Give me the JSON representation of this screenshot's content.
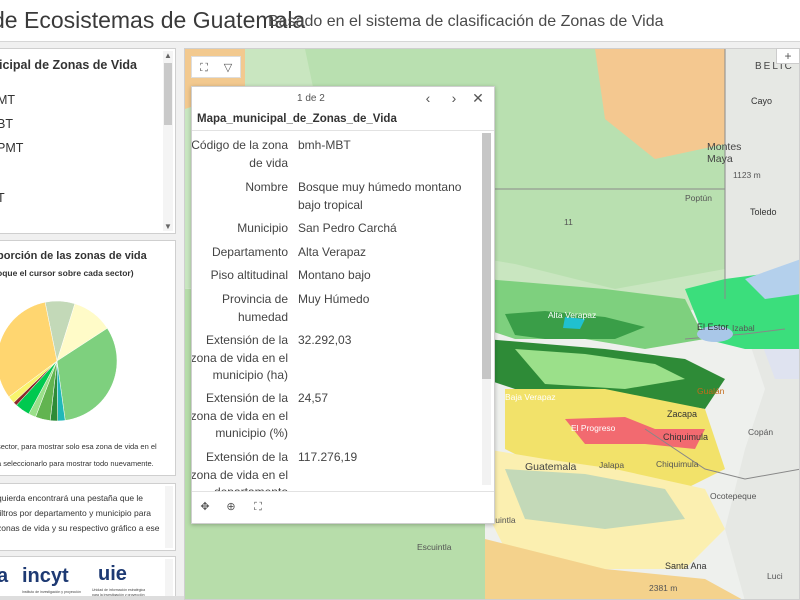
{
  "header": {
    "title": "de Ecosistemas de Guatemala",
    "subtitle": "Basado en el sistema de clasificación de Zonas de Vida"
  },
  "list_panel": {
    "title": "icipal de Zonas de Vida",
    "items": [
      "MT",
      "BT",
      "PMT",
      "T"
    ]
  },
  "chart_panel": {
    "title": "porción de las zonas de vida",
    "subtitle": "oque el cursor sobre cada sector)",
    "note_1": "sector, para mostrar solo esa zona de vida en el",
    "note_2": "a seleccionarlo para mostrar todo nuevamente."
  },
  "chart_data": {
    "type": "pie",
    "slices": [
      {
        "color": "#c3d9b8",
        "value": 8
      },
      {
        "color": "#fffbc8",
        "value": 11
      },
      {
        "color": "#7ed07e",
        "value": 32
      },
      {
        "color": "#20b8b8",
        "value": 2
      },
      {
        "color": "#2e8b37",
        "value": 2
      },
      {
        "color": "#62b450",
        "value": 4
      },
      {
        "color": "#9be08a",
        "value": 2
      },
      {
        "color": "#00c94f",
        "value": 4
      },
      {
        "color": "#8b2b2b",
        "value": 1
      },
      {
        "color": "#f8f46e",
        "value": 2
      },
      {
        "color": "#ffd670",
        "value": 32
      }
    ]
  },
  "text_panel": {
    "lines": [
      "quierda encontrará una pestaña que le",
      "filtros por departamento y municipio para",
      "zonas de vida y su respectivo gráfico a ese"
    ]
  },
  "logos": {
    "first": "a",
    "second": "incyt",
    "third": "uie",
    "second_small": "Instituto de investigación y proyección",
    "third_small_1": "Unidad de información estratégica",
    "third_small_2": "para la investigación y proyección"
  },
  "popup": {
    "pager": "1 de 2",
    "title": "Mapa_municipal_de_Zonas_de_Vida",
    "fields": [
      {
        "label": "Código de la zona de vida",
        "value": "bmh-MBT"
      },
      {
        "label": "Nombre",
        "value": "Bosque muy húmedo montano bajo tropical"
      },
      {
        "label": "Municipio",
        "value": "San Pedro Carchá"
      },
      {
        "label": "Departamento",
        "value": "Alta Verapaz"
      },
      {
        "label": "Piso altitudinal",
        "value": "Montano bajo"
      },
      {
        "label": "Provincia de humedad",
        "value": "Muy Húmedo"
      },
      {
        "label": "Extensión de la zona de vida en el municipio (ha)",
        "value": "32.292,03"
      },
      {
        "label": "Extensión de la zona de vida en el municipio (%)",
        "value": "24,57"
      },
      {
        "label": "Extensión de la zona de vida en el departamento",
        "value": "117.276,19"
      }
    ]
  },
  "map": {
    "labels": {
      "belice": "BELIC",
      "cayo": "Cayo",
      "montes_maya": "Montes\nMaya",
      "elev_1123": "1123 m",
      "toledo": "Toledo",
      "poptun": "Poptún",
      "hwy_11": "11",
      "alta_verapaz": "Alta Verapaz",
      "el_estor": "El Estor",
      "izabal": "Izabal",
      "gualan": "Gualán",
      "baja_verapaz": "Baja Verapaz",
      "zacapa": "Zacapa",
      "el_progreso": "El Progreso",
      "chiquimula": "Chiquimula",
      "copan": "Copán",
      "guatemala": "Guatemala",
      "jalapa": "Jalapa",
      "chiquimula2": "Chiquimula",
      "ocotepeque": "Ocotepeque",
      "escuintla": "Escuintla",
      "cuintla": "cuintla",
      "santa_ana": "Santa Ana",
      "elev_2381": "2381 m",
      "lucia": "Luci"
    }
  }
}
